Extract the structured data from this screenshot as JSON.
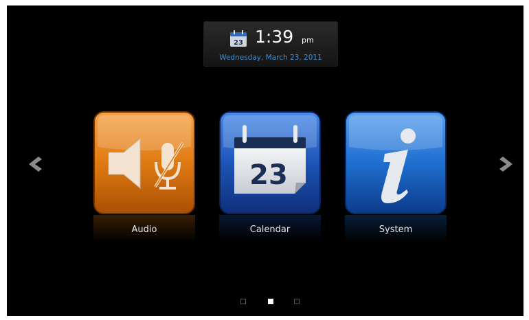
{
  "clock": {
    "day_number": "23",
    "time": "1:39",
    "ampm": "pm",
    "date": "Wednesday, March 23, 2011",
    "date_color": "#3d8fd4"
  },
  "apps": [
    {
      "label": "Audio",
      "icon": "audio-muted-icon",
      "color": "#e07a12"
    },
    {
      "label": "Calendar",
      "icon": "calendar-icon",
      "color": "#1d55b8",
      "calendar_number": "23"
    },
    {
      "label": "System",
      "icon": "info-icon",
      "color": "#1f6fd0"
    }
  ],
  "navigation": {
    "prev_icon": "chevron-left-icon",
    "next_icon": "chevron-right-icon"
  },
  "pagination": {
    "total": 3,
    "active_index": 1
  }
}
